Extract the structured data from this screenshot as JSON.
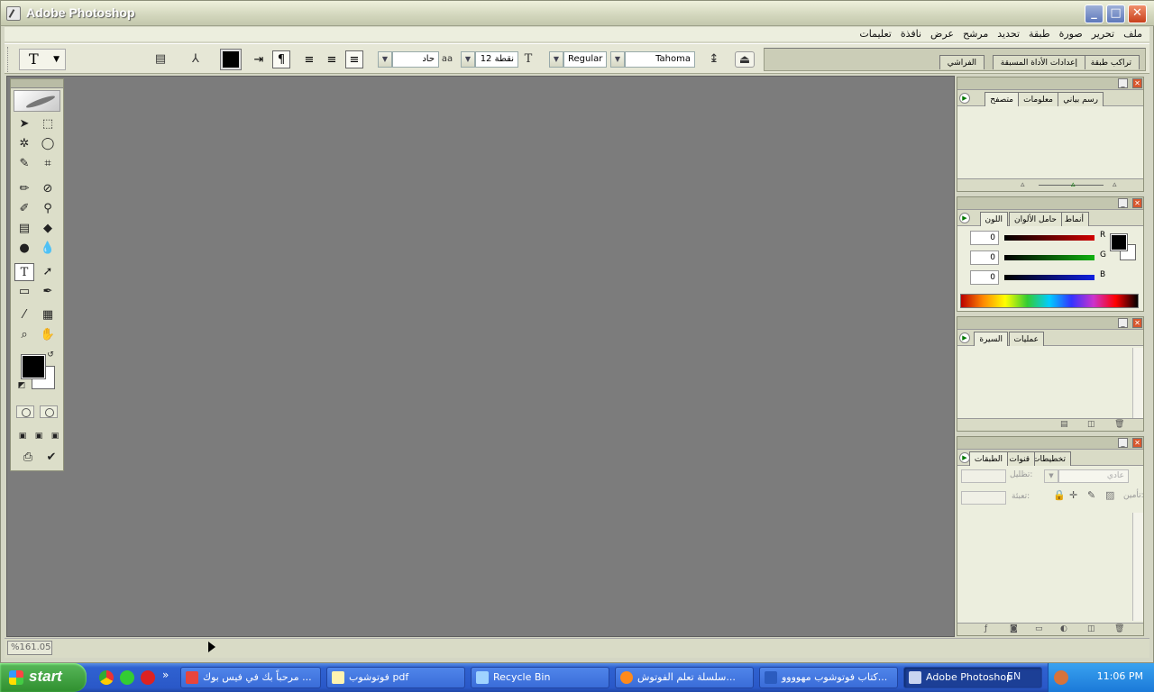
{
  "window": {
    "title": "Adobe Photoshop",
    "controls": {
      "minimize": "_",
      "maximize": "□",
      "close": "✕"
    }
  },
  "menu": [
    "ملف",
    "تحرير",
    "صورة",
    "طبقة",
    "تحديد",
    "مرشح",
    "عرض",
    "نافذة",
    "تعليمات"
  ],
  "options": {
    "tool_glyph": "T",
    "font_family": "Tahoma",
    "font_style": "Regular",
    "font_size": "12 نقطة",
    "antialias": "حاد",
    "aa_icon": "aa",
    "well_tabs": [
      "تراكب طبقة",
      "إعدادات الأداة المسبقة",
      "الفراشي"
    ]
  },
  "statusbar": {
    "zoom": "%161.05"
  },
  "palettes": {
    "navigator": {
      "tabs": [
        "رسم بياني",
        "معلومات",
        "متصفح"
      ]
    },
    "color": {
      "tabs": [
        "أنماط",
        "حامل الألوان",
        "اللون"
      ],
      "channels": [
        {
          "label": "R",
          "value": "0",
          "color": "#d00000"
        },
        {
          "label": "G",
          "value": "0",
          "color": "#10b010"
        },
        {
          "label": "B",
          "value": "0",
          "color": "#1020e0"
        }
      ]
    },
    "history": {
      "tabs": [
        "عمليات",
        "السيرة"
      ]
    },
    "layers": {
      "tabs": [
        "تخطيطات",
        "قنوات",
        "الطبقات"
      ],
      "blend_mode": "عادي",
      "opacity_label": "تظليل:",
      "lock_label": "تأمين:",
      "fill_label": "تعبئة:"
    }
  },
  "taskbar": {
    "start": "start",
    "tasks": [
      {
        "label": "مرحباً بك في فيس بوك ...",
        "icon_color": "#e8453c"
      },
      {
        "label": "فوتوشوب pdf",
        "icon_color": "#fff3b0"
      },
      {
        "label": "Recycle Bin",
        "icon_color": "#9fd3ff"
      },
      {
        "label": "سلسلة تعلم الفوتوش...",
        "icon_color": "#ff8a1c"
      },
      {
        "label": "كتاب فوتوشوب مهوووو...",
        "icon_color": "#2b5cbf"
      },
      {
        "label": "Adobe Photoshop",
        "icon_color": "#c9d4f0"
      }
    ],
    "language": "EN",
    "time": "11:06 PM"
  }
}
